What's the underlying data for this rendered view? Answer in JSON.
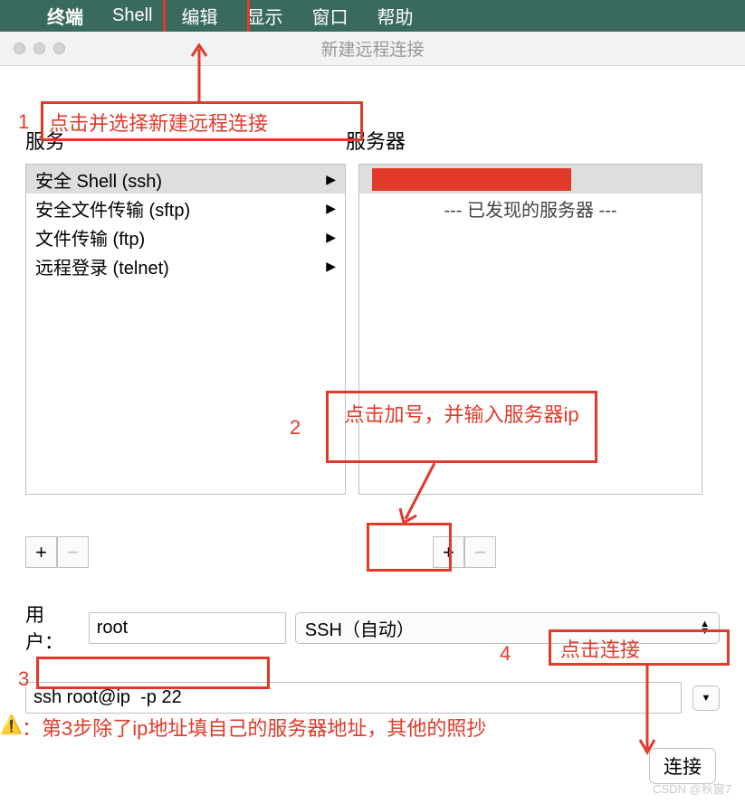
{
  "menubar": {
    "items": [
      "终端",
      "Shell",
      "编辑",
      "显示",
      "窗口",
      "帮助"
    ]
  },
  "window": {
    "title": "新建远程连接"
  },
  "section": {
    "service": "服务",
    "server": "服务器"
  },
  "services": [
    "安全 Shell (ssh)",
    "安全文件传输 (sftp)",
    "文件传输 (ftp)",
    "远程登录 (telnet)"
  ],
  "servers": {
    "discovered": "--- 已发现的服务器 ---"
  },
  "buttons": {
    "plus": "+",
    "minus": "−"
  },
  "user": {
    "label": "用户：",
    "value": "root"
  },
  "ssh_mode": "SSH（自动）",
  "command": "ssh root@ip  -p 22",
  "connect": "连接",
  "annotations": {
    "n1": "1",
    "t1": "点击并选择新建远程连接",
    "n2": "2",
    "t2": "点击加号，并输入服务器ip",
    "n3": "3",
    "n4": "4",
    "t4": "点击连接",
    "warn": "：第3步除了ip地址填自己的服务器地址，其他的照抄"
  },
  "watermark": "CSDN @秋窗7"
}
